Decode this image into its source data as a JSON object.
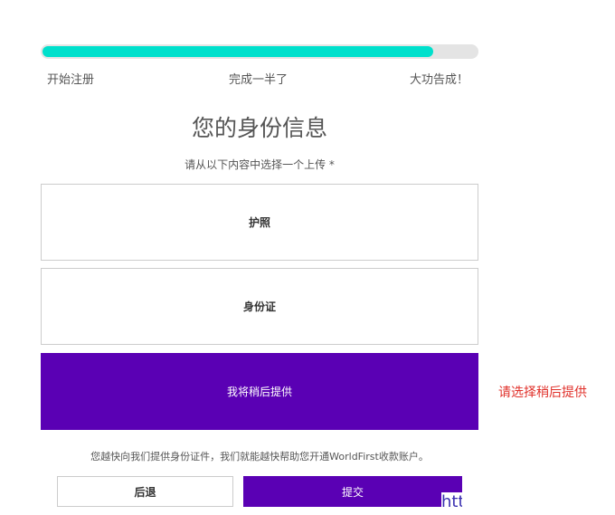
{
  "progress": {
    "fraction": 0.9,
    "color": "#00e0cc",
    "steps": [
      "开始注册",
      "完成一半了",
      "大功告成！"
    ]
  },
  "title": "您的身份信息",
  "subtitle": "请从以下内容中选择一个上传 *",
  "options": [
    {
      "label": "护照",
      "selected": false
    },
    {
      "label": "身份证",
      "selected": false
    },
    {
      "label": "我将稍后提供",
      "selected": true
    }
  ],
  "error": "请选择稍后提供",
  "note": "您越快向我们提供身份证件，我们就能越快帮助您开通WorldFirst收款账户。",
  "buttons": {
    "back": "后退",
    "submit": "提交"
  },
  "overlay_text": "htt",
  "accent": "#5a00b4"
}
